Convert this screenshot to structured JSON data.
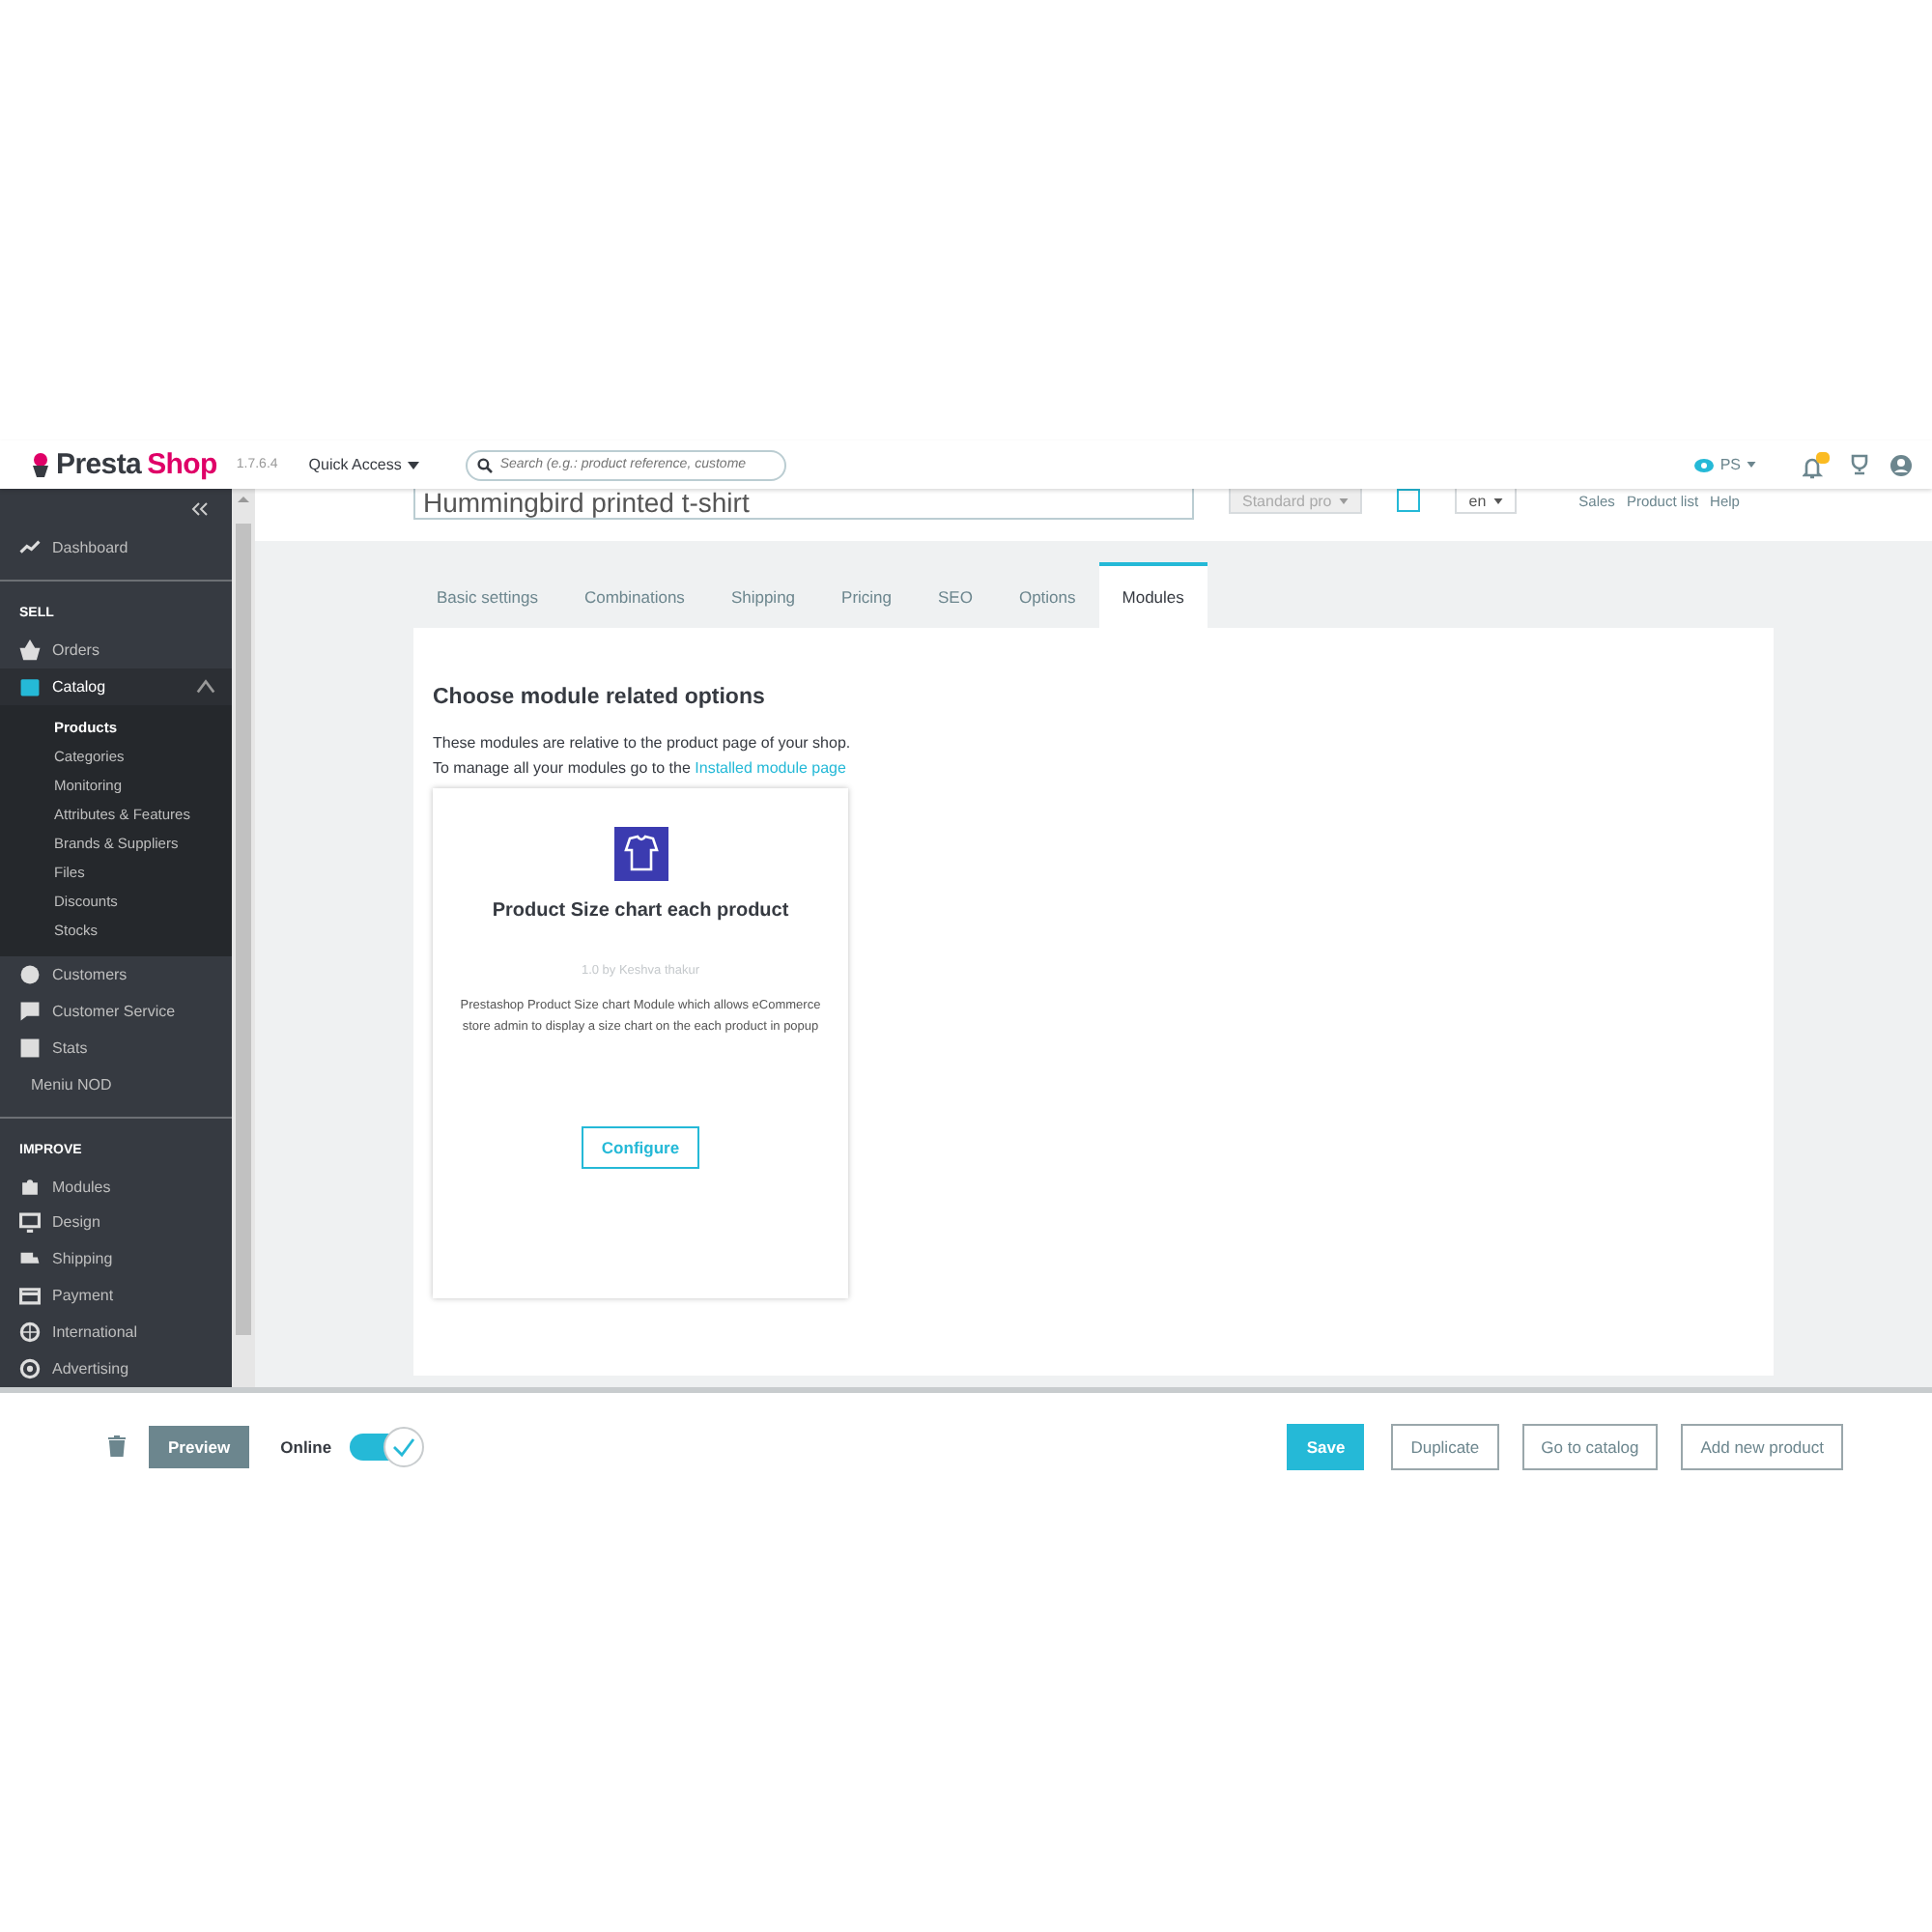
{
  "header": {
    "logo": [
      {
        "text": "Presta",
        "color": "#363a41"
      },
      {
        "text": "Shop",
        "color": "#df0067"
      }
    ],
    "version": "1.7.6.4",
    "quick_access": "Quick Access",
    "search": {
      "placeholder": "Search (e.g.: product reference, custome"
    },
    "shop_menu": "PS"
  },
  "sidebar": {
    "top": [
      {
        "label": "Dashboard",
        "kind": "icon",
        "selected": false
      }
    ],
    "groups": [
      {
        "title": "SELL",
        "items": [
          {
            "label": "Orders",
            "kind": "icon",
            "selected": false
          },
          {
            "label": "Catalog",
            "kind": "icon",
            "selected": true,
            "expanded": true,
            "children": [
              {
                "label": "Products",
                "selected": true
              },
              {
                "label": "Categories",
                "selected": false
              },
              {
                "label": "Monitoring",
                "selected": false
              },
              {
                "label": "Attributes & Features",
                "selected": false
              },
              {
                "label": "Brands & Suppliers",
                "selected": false
              },
              {
                "label": "Files",
                "selected": false
              },
              {
                "label": "Discounts",
                "selected": false
              },
              {
                "label": "Stocks",
                "selected": false
              }
            ]
          },
          {
            "label": "Customers",
            "kind": "icon",
            "selected": false
          },
          {
            "label": "Customer Service",
            "kind": "icon",
            "selected": false
          },
          {
            "label": "Stats",
            "kind": "icon",
            "selected": false
          },
          {
            "label": "Meniu NOD",
            "kind": "plain",
            "selected": false
          }
        ]
      },
      {
        "title": "IMPROVE",
        "items": [
          {
            "label": "Modules",
            "kind": "icon",
            "selected": false
          },
          {
            "label": "Design",
            "kind": "icon",
            "selected": false
          },
          {
            "label": "Shipping",
            "kind": "icon",
            "selected": false
          },
          {
            "label": "Payment",
            "kind": "icon",
            "selected": false
          },
          {
            "label": "International",
            "kind": "icon",
            "selected": false
          },
          {
            "label": "Advertising",
            "kind": "icon",
            "selected": false
          }
        ]
      }
    ]
  },
  "product": {
    "name": "Hummingbird printed t-shirt",
    "type": "Standard pro",
    "lang": "en",
    "links": [
      "Sales",
      "Product list",
      "Help"
    ]
  },
  "tabs": [
    {
      "label": "Basic settings",
      "selected": false
    },
    {
      "label": "Combinations",
      "selected": false
    },
    {
      "label": "Shipping",
      "selected": false
    },
    {
      "label": "Pricing",
      "selected": false
    },
    {
      "label": "SEO",
      "selected": false
    },
    {
      "label": "Options",
      "selected": false
    },
    {
      "label": "Modules",
      "selected": true
    }
  ],
  "panel": {
    "heading": "Choose module related options",
    "intro": "These modules are relative to the product page of your shop.",
    "manage_text": "To manage all your modules go to the",
    "manage_link": "Installed module page",
    "modules": [
      {
        "name": "Product Size chart each product",
        "version": "1.0 by Keshva thakur",
        "description": "Prestashop Product Size chart Module which allows eCommerce store admin to display a size chart on the each product in popup",
        "button": "Configure"
      }
    ]
  },
  "footer": {
    "preview": "Preview",
    "online_label": "Online",
    "online": true,
    "buttons": [
      {
        "label": "Save",
        "kind": "primary"
      },
      {
        "label": "Duplicate",
        "kind": "outline"
      },
      {
        "label": "Go to catalog",
        "kind": "outline"
      },
      {
        "label": "Add new product",
        "kind": "outline"
      }
    ]
  }
}
